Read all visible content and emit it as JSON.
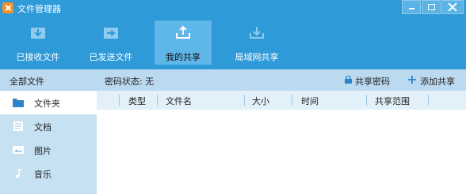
{
  "window": {
    "title": "文件管理器"
  },
  "toolbar": {
    "buttons": [
      {
        "label": "已接收文件",
        "icon": "inbox-download-icon"
      },
      {
        "label": "已发送文件",
        "icon": "send-file-icon"
      },
      {
        "label": "我的共享",
        "icon": "upload-share-icon",
        "active": true
      },
      {
        "label": "局域网共享",
        "icon": "lan-download-icon"
      }
    ]
  },
  "sidebar": {
    "header": "全部文件",
    "items": [
      {
        "label": "文件夹",
        "icon": "folder-icon",
        "selected": true
      },
      {
        "label": "文档",
        "icon": "document-icon"
      },
      {
        "label": "图片",
        "icon": "image-icon"
      },
      {
        "label": "音乐",
        "icon": "music-note-icon"
      }
    ]
  },
  "main": {
    "password_status": "密码状态: 无",
    "share_password": "共享密码",
    "add_share": "添加共享",
    "columns": [
      "类型",
      "文件名",
      "大小",
      "时间",
      "共享范围"
    ]
  },
  "colors": {
    "title_bar": "#2e9ad8",
    "active_toolbar": "#5fb6e8",
    "sidebar_bg": "#c6e1f2",
    "header_bg": "#bbd9ef",
    "column_header_bg": "#e2f0fa"
  }
}
